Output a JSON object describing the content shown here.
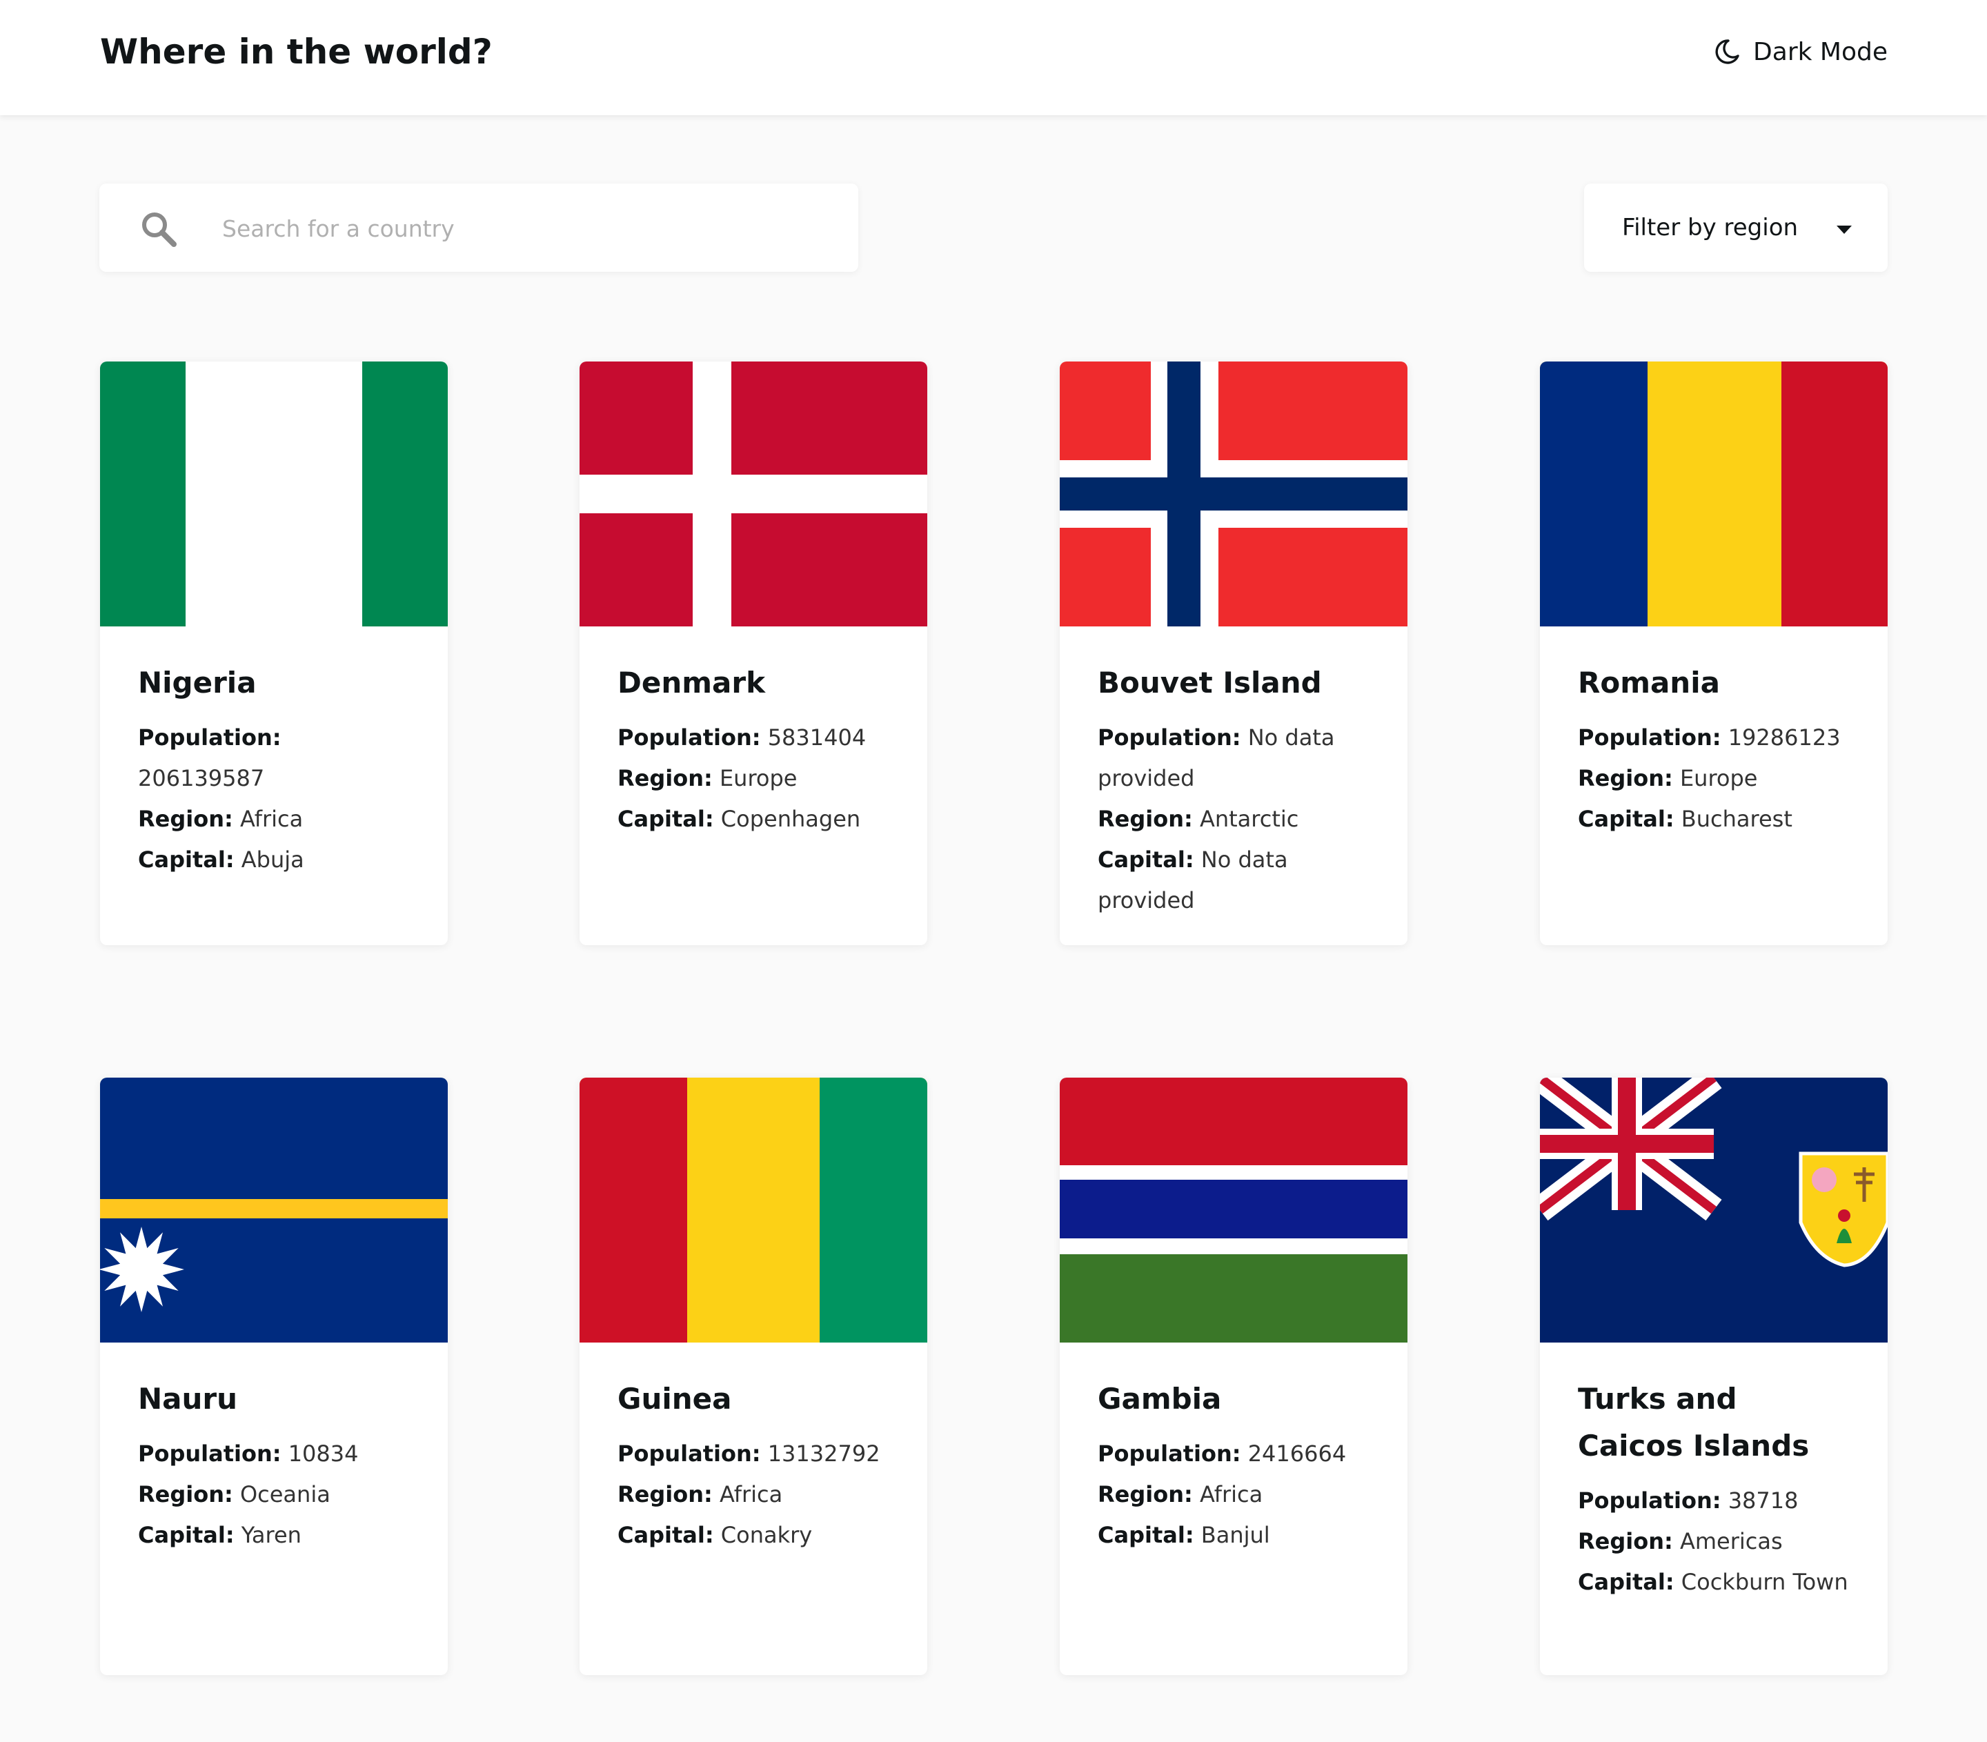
{
  "header": {
    "title": "Where in the world?",
    "dark_mode_label": "Dark Mode",
    "dark_mode_icon": "moon-icon"
  },
  "search": {
    "placeholder": "Search for a country",
    "value": "",
    "icon": "search-icon"
  },
  "filter": {
    "label": "Filter by region",
    "icon": "caret-down-icon"
  },
  "labels": {
    "population": "Population:",
    "region": "Region:",
    "capital": "Capital:"
  },
  "countries": [
    {
      "name": "Nigeria",
      "population": "206139587",
      "region": "Africa",
      "capital": "Abuja",
      "flag": "nigeria-flag"
    },
    {
      "name": "Denmark",
      "population": "5831404",
      "region": "Europe",
      "capital": "Copenhagen",
      "flag": "denmark-flag"
    },
    {
      "name": "Bouvet Island",
      "population": "No data provided",
      "region": "Antarctic",
      "capital": "No data provided",
      "flag": "bouvet-island-flag"
    },
    {
      "name": "Romania",
      "population": "19286123",
      "region": "Europe",
      "capital": "Bucharest",
      "flag": "romania-flag"
    },
    {
      "name": "Nauru",
      "population": "10834",
      "region": "Oceania",
      "capital": "Yaren",
      "flag": "nauru-flag"
    },
    {
      "name": "Guinea",
      "population": "13132792",
      "region": "Africa",
      "capital": "Conakry",
      "flag": "guinea-flag"
    },
    {
      "name": "Gambia",
      "population": "2416664",
      "region": "Africa",
      "capital": "Banjul",
      "flag": "gambia-flag"
    },
    {
      "name": "Turks and Caicos Islands",
      "population": "38718",
      "region": "Americas",
      "capital": "Cockburn Town",
      "flag": "turks-and-caicos-flag"
    }
  ],
  "colors": {
    "background": "#fafafa",
    "element": "#ffffff",
    "text": "#111517",
    "placeholder": "#b0b0b0"
  }
}
